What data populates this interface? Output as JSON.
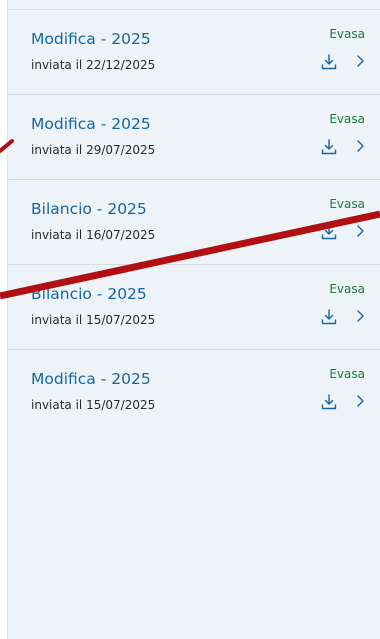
{
  "requests": [
    {
      "title": "Modifica - 2025",
      "date": "inviata il 22/12/2025",
      "status": "Evasa"
    },
    {
      "title": "Modifica - 2025",
      "date": "inviata il 29/07/2025",
      "status": "Evasa"
    },
    {
      "title": "Bilancio - 2025",
      "date": "inviata il 16/07/2025",
      "status": "Evasa"
    },
    {
      "title": "Bilancio - 2025",
      "date": "inviata il 15/07/2025",
      "status": "Evasa"
    },
    {
      "title": "Modifica - 2025",
      "date": "inviata il 15/07/2025",
      "status": "Evasa"
    }
  ],
  "colors": {
    "title": "#1466a8",
    "status_ok": "#1f7a3c",
    "panel_bg": "#eef3f8",
    "annotation": "#b10f12"
  },
  "icons": {
    "download": "download-icon",
    "chevron": "chevron-right-icon"
  }
}
